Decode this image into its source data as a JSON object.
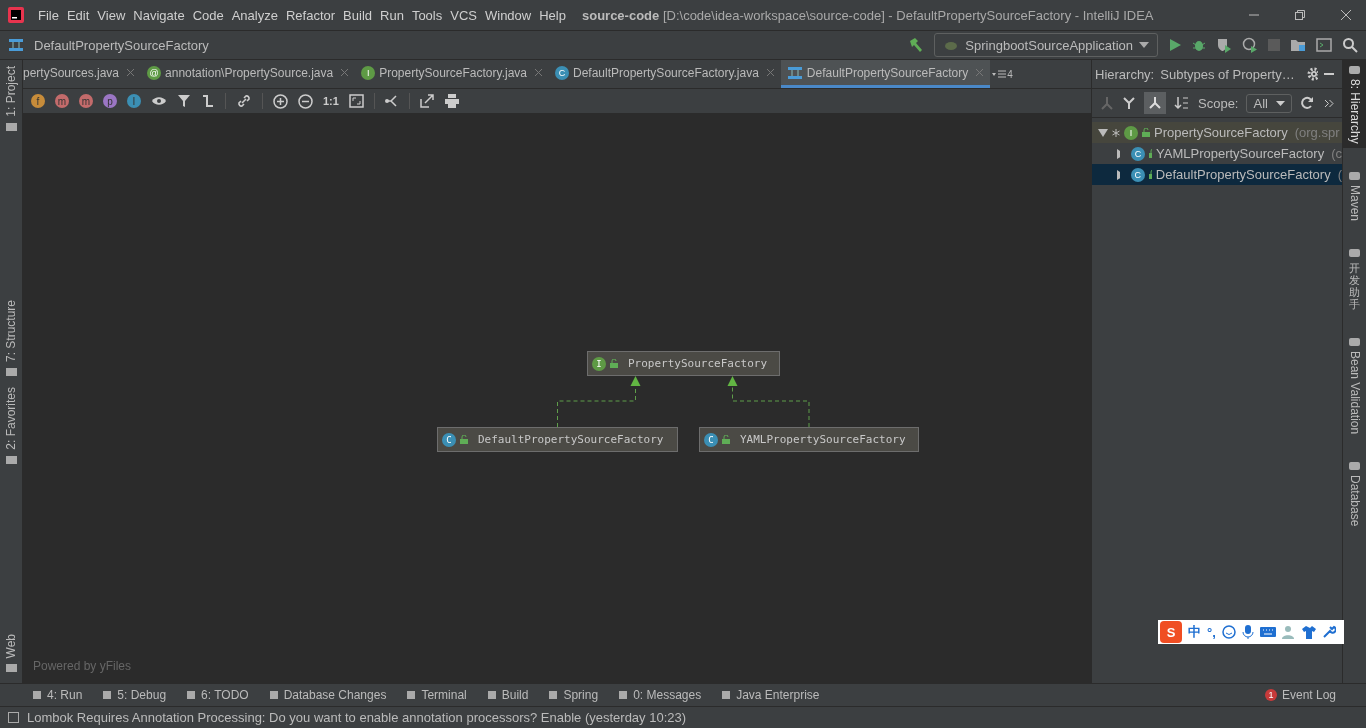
{
  "window": {
    "project": "source-code",
    "title": "[D:\\code\\idea-workspace\\source-code] - DefaultPropertySourceFactory - IntelliJ IDEA"
  },
  "menu": [
    "File",
    "Edit",
    "View",
    "Navigate",
    "Code",
    "Analyze",
    "Refactor",
    "Build",
    "Run",
    "Tools",
    "VCS",
    "Window",
    "Help"
  ],
  "navbar": {
    "breadcrumb": "DefaultPropertySourceFactory",
    "run_config": "SpringbootSourceApplication"
  },
  "left_stripe": [
    {
      "label": "1: Project",
      "selected": false
    },
    {
      "label": "7: Structure",
      "selected": false
    },
    {
      "label": "2: Favorites",
      "selected": false
    },
    {
      "label": "Web",
      "selected": false
    }
  ],
  "tabs": [
    {
      "label": "pertySources.java",
      "kind": "none",
      "selected": false
    },
    {
      "label": "annotation\\PropertySource.java",
      "kind": "annotation",
      "badge": "@",
      "selected": false
    },
    {
      "label": "PropertySourceFactory.java",
      "kind": "interface",
      "badge": "I",
      "selected": false
    },
    {
      "label": "DefaultPropertySourceFactory.java",
      "kind": "class",
      "badge": "C",
      "selected": false
    },
    {
      "label": "DefaultPropertySourceFactory",
      "kind": "diagram",
      "selected": true
    }
  ],
  "tab_overflow": "4",
  "diagram_toolbar": {
    "filters": [
      {
        "letter": "f",
        "color": "#c78c3a"
      },
      {
        "letter": "m",
        "color": "#c36b6b"
      },
      {
        "letter": "m",
        "color": "#c36b6b"
      },
      {
        "letter": "p",
        "color": "#9b76c4"
      },
      {
        "letter": "I",
        "color": "#3b8fb4"
      }
    ],
    "actual_size": "1:1"
  },
  "diagram": {
    "nodes": [
      {
        "label": "PropertySourceFactory",
        "kind": "interface",
        "badge": "I"
      },
      {
        "label": "DefaultPropertySourceFactory",
        "kind": "class",
        "badge": "C"
      },
      {
        "label": "YAMLPropertySourceFactory",
        "kind": "class",
        "badge": "C"
      }
    ],
    "footer": "Powered by yFiles"
  },
  "hierarchy": {
    "title": "Hierarchy:",
    "subtitle": "Subtypes of Property…",
    "scope_label": "Scope:",
    "scope": "All",
    "tree": [
      {
        "label": "PropertySourceFactory",
        "suffix": "(org.spr",
        "kind": "interface",
        "badge": "I",
        "current": true,
        "selected": false,
        "expanded": true,
        "children": [
          {
            "label": "YAMLPropertySourceFactory",
            "suffix": "(c",
            "kind": "class",
            "badge": "C",
            "current": false,
            "selected": false,
            "expanded": false
          },
          {
            "label": "DefaultPropertySourceFactory",
            "suffix": "(",
            "kind": "class",
            "badge": "C",
            "current": false,
            "selected": true,
            "expanded": false
          }
        ]
      }
    ]
  },
  "right_stripe": [
    {
      "label": "8: Hierarchy",
      "kind": "latin",
      "selected": true
    },
    {
      "label": "Maven",
      "kind": "latin",
      "selected": false
    },
    {
      "label": "开发助手",
      "kind": "cjk",
      "selected": false
    },
    {
      "label": "Bean Validation",
      "kind": "latin",
      "selected": false
    },
    {
      "label": "Database",
      "kind": "latin",
      "selected": false
    }
  ],
  "ime": {
    "logo": "S",
    "mode": "中",
    "punct": "°,"
  },
  "tool_windows": [
    "4: Run",
    "5: Debug",
    "6: TODO",
    "Database Changes",
    "Terminal",
    "Build",
    "Spring",
    "0: Messages",
    "Java Enterprise"
  ],
  "event_log": {
    "count": "1",
    "label": "Event Log"
  },
  "status": "Lombok Requires Annotation Processing: Do you want to enable annotation processors? Enable (yesterday 10:23)"
}
